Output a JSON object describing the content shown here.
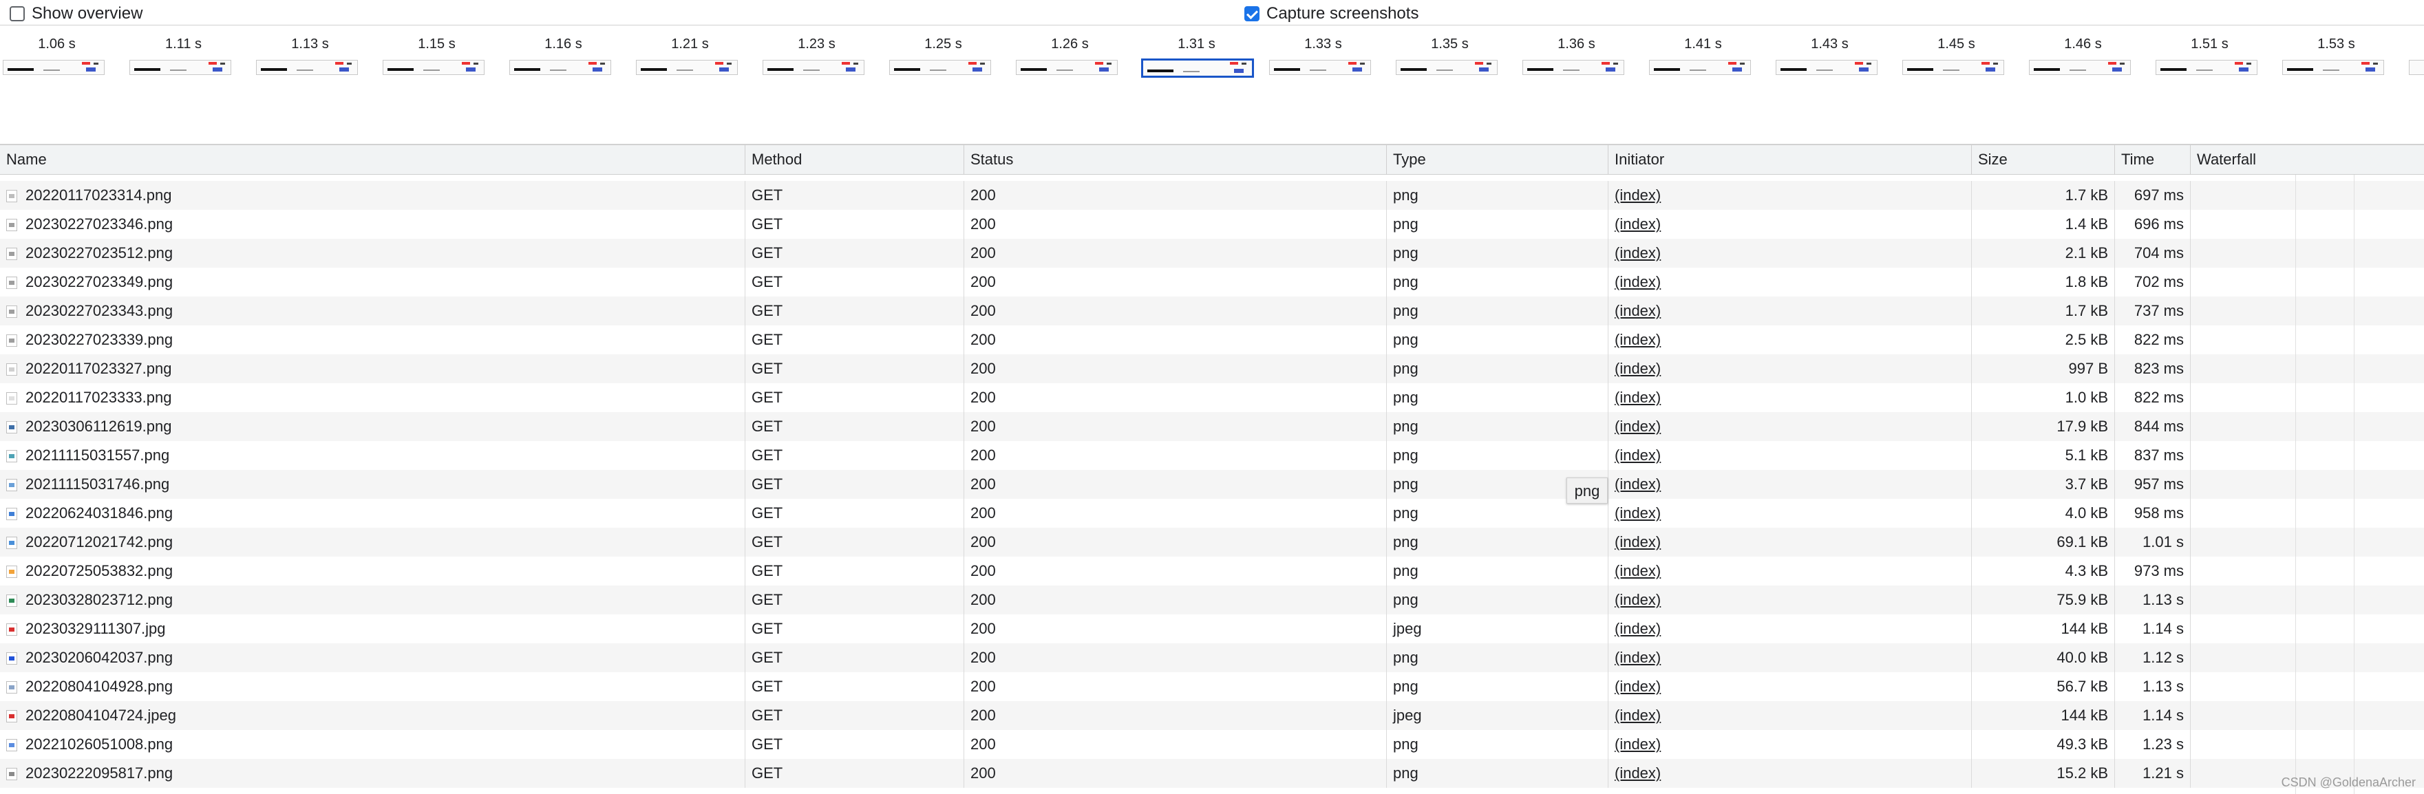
{
  "toolbar": {
    "show_overview": {
      "label": "Show overview",
      "checked": false
    },
    "capture_screenshots": {
      "label": "Capture screenshots",
      "checked": true
    }
  },
  "filmstrip": {
    "frames": [
      "1.06 s",
      "1.11 s",
      "1.13 s",
      "1.15 s",
      "1.16 s",
      "1.21 s",
      "1.23 s",
      "1.25 s",
      "1.26 s",
      "1.31 s",
      "1.33 s",
      "1.35 s",
      "1.36 s",
      "1.41 s",
      "1.43 s",
      "1.45 s",
      "1.46 s",
      "1.51 s",
      "1.53 s"
    ],
    "selected": "1.31 s"
  },
  "table": {
    "columns": [
      "Name",
      "Method",
      "Status",
      "Type",
      "Initiator",
      "Size",
      "Time",
      "Waterfall"
    ],
    "rows": [
      {
        "name": "20220117023314.png",
        "method": "GET",
        "status": "200",
        "type": "png",
        "initiator": "(index)",
        "size": "1.7 kB",
        "time": "697 ms",
        "icon_color": "#bdbdbd"
      },
      {
        "name": "20230227023346.png",
        "method": "GET",
        "status": "200",
        "type": "png",
        "initiator": "(index)",
        "size": "1.4 kB",
        "time": "696 ms",
        "icon_color": "#9e9e9e"
      },
      {
        "name": "20230227023512.png",
        "method": "GET",
        "status": "200",
        "type": "png",
        "initiator": "(index)",
        "size": "2.1 kB",
        "time": "704 ms",
        "icon_color": "#9e9e9e"
      },
      {
        "name": "20230227023349.png",
        "method": "GET",
        "status": "200",
        "type": "png",
        "initiator": "(index)",
        "size": "1.8 kB",
        "time": "702 ms",
        "icon_color": "#9e9e9e"
      },
      {
        "name": "20230227023343.png",
        "method": "GET",
        "status": "200",
        "type": "png",
        "initiator": "(index)",
        "size": "1.7 kB",
        "time": "737 ms",
        "icon_color": "#9e9e9e"
      },
      {
        "name": "20230227023339.png",
        "method": "GET",
        "status": "200",
        "type": "png",
        "initiator": "(index)",
        "size": "2.5 kB",
        "time": "822 ms",
        "icon_color": "#9e9e9e"
      },
      {
        "name": "20220117023327.png",
        "method": "GET",
        "status": "200",
        "type": "png",
        "initiator": "(index)",
        "size": "997 B",
        "time": "823 ms",
        "icon_color": "#d0d0d0"
      },
      {
        "name": "20220117023333.png",
        "method": "GET",
        "status": "200",
        "type": "png",
        "initiator": "(index)",
        "size": "1.0 kB",
        "time": "822 ms",
        "icon_color": "#e0e0e0"
      },
      {
        "name": "20230306112619.png",
        "method": "GET",
        "status": "200",
        "type": "png",
        "initiator": "(index)",
        "size": "17.9 kB",
        "time": "844 ms",
        "icon_color": "#3f6fa8"
      },
      {
        "name": "20211115031557.png",
        "method": "GET",
        "status": "200",
        "type": "png",
        "initiator": "(index)",
        "size": "5.1 kB",
        "time": "837 ms",
        "icon_color": "#4fa3b5"
      },
      {
        "name": "20211115031746.png",
        "method": "GET",
        "status": "200",
        "type": "png",
        "initiator": "(index)",
        "size": "3.7 kB",
        "time": "957 ms",
        "icon_color": "#6aa0d8"
      },
      {
        "name": "20220624031846.png",
        "method": "GET",
        "status": "200",
        "type": "png",
        "initiator": "(index)",
        "size": "4.0 kB",
        "time": "958 ms",
        "icon_color": "#3f7fd6"
      },
      {
        "name": "20220712021742.png",
        "method": "GET",
        "status": "200",
        "type": "png",
        "initiator": "(index)",
        "size": "69.1 kB",
        "time": "1.01 s",
        "icon_color": "#4a90d9"
      },
      {
        "name": "20220725053832.png",
        "method": "GET",
        "status": "200",
        "type": "png",
        "initiator": "(index)",
        "size": "4.3 kB",
        "time": "973 ms",
        "icon_color": "#f2a33a"
      },
      {
        "name": "20230328023712.png",
        "method": "GET",
        "status": "200",
        "type": "png",
        "initiator": "(index)",
        "size": "75.9 kB",
        "time": "1.13 s",
        "icon_color": "#2e8b57"
      },
      {
        "name": "20230329111307.jpg",
        "method": "GET",
        "status": "200",
        "type": "jpeg",
        "initiator": "(index)",
        "size": "144 kB",
        "time": "1.14 s",
        "icon_color": "#d93030"
      },
      {
        "name": "20230206042037.png",
        "method": "GET",
        "status": "200",
        "type": "png",
        "initiator": "(index)",
        "size": "40.0 kB",
        "time": "1.12 s",
        "icon_color": "#2152d9"
      },
      {
        "name": "20220804104928.png",
        "method": "GET",
        "status": "200",
        "type": "png",
        "initiator": "(index)",
        "size": "56.7 kB",
        "time": "1.13 s",
        "icon_color": "#8aa4c8"
      },
      {
        "name": "20220804104724.jpeg",
        "method": "GET",
        "status": "200",
        "type": "jpeg",
        "initiator": "(index)",
        "size": "144 kB",
        "time": "1.14 s",
        "icon_color": "#d93030"
      },
      {
        "name": "20221026051008.png",
        "method": "GET",
        "status": "200",
        "type": "png",
        "initiator": "(index)",
        "size": "49.3 kB",
        "time": "1.23 s",
        "icon_color": "#5b8de0"
      },
      {
        "name": "20230222095817.png",
        "method": "GET",
        "status": "200",
        "type": "png",
        "initiator": "(index)",
        "size": "15.2 kB",
        "time": "1.21 s",
        "icon_color": "#8a8a8a"
      }
    ]
  },
  "tooltip": {
    "text": "png"
  },
  "watermark": "CSDN @GoldenaArcher"
}
